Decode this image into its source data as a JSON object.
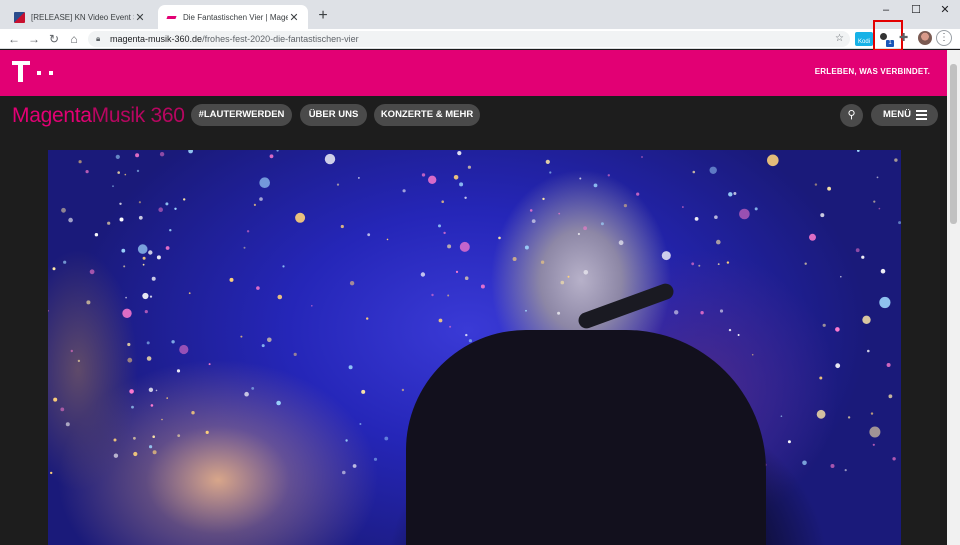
{
  "browser": {
    "tabs": [
      {
        "title": "[RELEASE] KN Video Event Servic",
        "active": false
      },
      {
        "title": "Die Fantastischen Vier | Magenta",
        "active": true
      }
    ],
    "new_tab": "+",
    "window": {
      "minimize": "–",
      "maximize": "☐",
      "close": "✕"
    },
    "nav": {
      "back": "←",
      "forward": "→",
      "reload": "↻",
      "home": "⌂"
    },
    "url_host": "magenta-musik-360.de",
    "url_path": "/frohes-fest-2020-die-fantastischen-vier",
    "extensions": {
      "kodi_label": "Kodi",
      "kn_badge": "1"
    },
    "highlight_color": "#e30000"
  },
  "site": {
    "accent_color": "#e20074",
    "claim": "ERLEBEN, WAS VERBINDET.",
    "brand_bold": "Magenta",
    "brand_light": "Musik 360",
    "nav_pills": [
      "#LAUTERWERDEN",
      "ÜBER UNS",
      "KONZERTE & MEHR"
    ],
    "menu_label": "MENÜ",
    "icons": {
      "search": "search-icon",
      "menu": "hamburger-icon",
      "logo": "telekom-t-logo"
    }
  }
}
